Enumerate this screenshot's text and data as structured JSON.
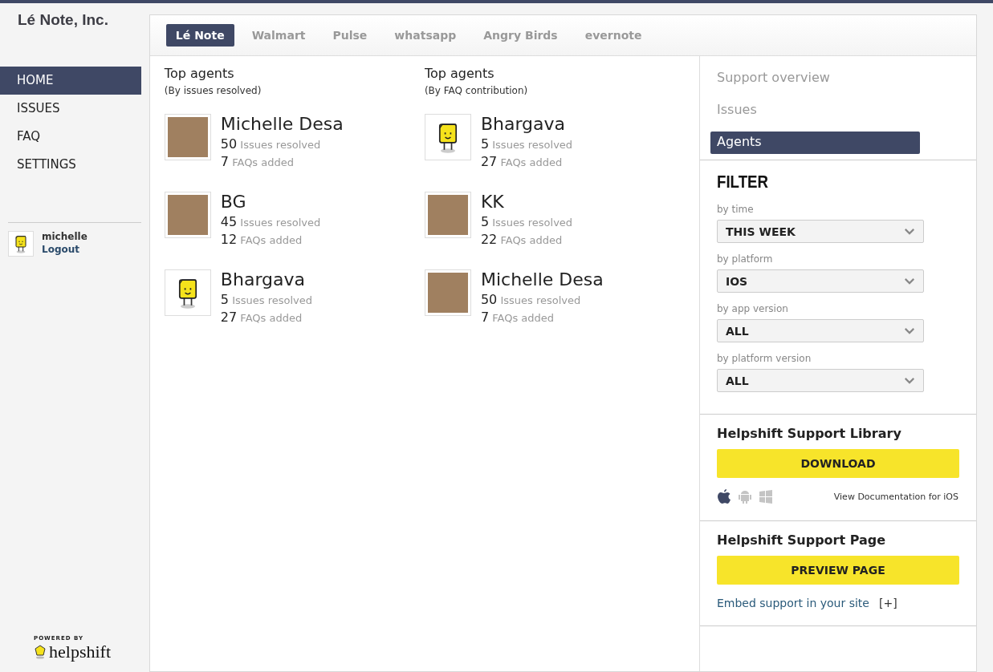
{
  "company": "Lé Note, Inc.",
  "nav": [
    {
      "label": "HOME",
      "selected": true
    },
    {
      "label": "ISSUES",
      "selected": false
    },
    {
      "label": "FAQ",
      "selected": false
    },
    {
      "label": "SETTINGS",
      "selected": false
    }
  ],
  "user": {
    "name": "michelle",
    "logout": "Logout"
  },
  "footer": {
    "powered_by": "POWERED BY",
    "brand": "helpshift"
  },
  "tabs": [
    {
      "label": "Lé Note",
      "selected": true
    },
    {
      "label": "Walmart",
      "selected": false
    },
    {
      "label": "Pulse",
      "selected": false
    },
    {
      "label": "whatsapp",
      "selected": false
    },
    {
      "label": "Angry Birds",
      "selected": false
    },
    {
      "label": "evernote",
      "selected": false
    }
  ],
  "columns": [
    {
      "title": "Top agents",
      "subtitle": "(By issues resolved)",
      "agents": [
        {
          "name": "Michelle Desa",
          "kind": "photo",
          "issues": "50",
          "issues_label": "Issues resolved",
          "faqs": "7",
          "faqs_label": "FAQs added"
        },
        {
          "name": "BG",
          "kind": "photo",
          "issues": "45",
          "issues_label": "Issues resolved",
          "faqs": "12",
          "faqs_label": "FAQs added"
        },
        {
          "name": "Bhargava",
          "kind": "mascot",
          "issues": "5",
          "issues_label": "Issues resolved",
          "faqs": "27",
          "faqs_label": "FAQs added"
        }
      ]
    },
    {
      "title": "Top agents",
      "subtitle": "(By FAQ contribution)",
      "agents": [
        {
          "name": "Bhargava",
          "kind": "mascot",
          "issues": "5",
          "issues_label": "Issues resolved",
          "faqs": "27",
          "faqs_label": "FAQs added"
        },
        {
          "name": "KK",
          "kind": "photo",
          "issues": "5",
          "issues_label": "Issues resolved",
          "faqs": "22",
          "faqs_label": "FAQs added"
        },
        {
          "name": "Michelle Desa",
          "kind": "photo",
          "issues": "50",
          "issues_label": "Issues resolved",
          "faqs": "7",
          "faqs_label": "FAQs added"
        }
      ]
    }
  ],
  "side_menu": [
    {
      "label": "Support overview",
      "selected": false
    },
    {
      "label": "Issues",
      "selected": false
    },
    {
      "label": "Agents",
      "selected": true
    }
  ],
  "filter": {
    "title": "FILTER",
    "fields": [
      {
        "label": "by time",
        "value": "THIS WEEK"
      },
      {
        "label": "by platform",
        "value": "IOS"
      },
      {
        "label": "by app version",
        "value": "ALL"
      },
      {
        "label": "by platform version",
        "value": "ALL"
      }
    ]
  },
  "library": {
    "title": "Helpshift Support Library",
    "button": "DOWNLOAD",
    "platforms": [
      {
        "kind": "apple",
        "selected": true
      },
      {
        "kind": "android",
        "selected": false
      },
      {
        "kind": "windows",
        "selected": false
      }
    ],
    "doc_link": "View Documentation for iOS"
  },
  "support_page": {
    "title": "Helpshift Support Page",
    "button": "PREVIEW PAGE",
    "embed_link": "Embed support in your site",
    "expand": "[+]"
  }
}
